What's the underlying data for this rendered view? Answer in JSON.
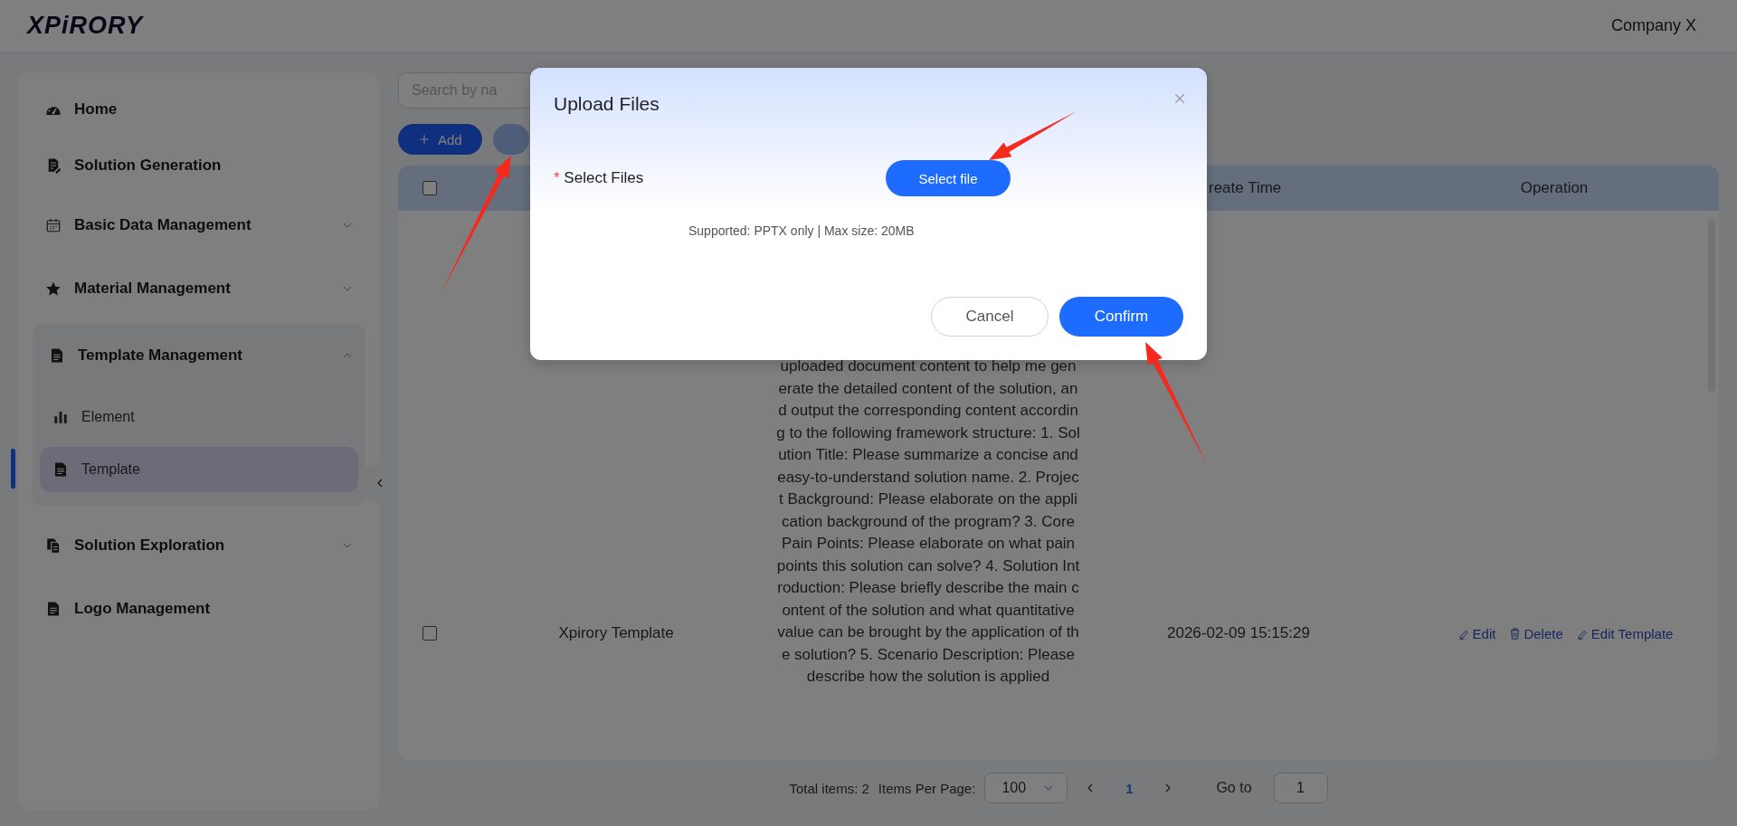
{
  "header": {
    "logo": "XPiRORY",
    "company": "Company X"
  },
  "sidebar": {
    "items": [
      {
        "label": "Home",
        "kind": "link",
        "selected": false
      },
      {
        "label": "Solution Generation",
        "kind": "link",
        "selected": false
      },
      {
        "label": "Basic Data Management",
        "kind": "group",
        "expanded": false,
        "selected": false
      },
      {
        "label": "Material Management",
        "kind": "group",
        "expanded": false,
        "selected": false
      },
      {
        "label": "Template Management",
        "kind": "group",
        "expanded": true,
        "selected": false,
        "children": [
          {
            "label": "Element",
            "selected": false
          },
          {
            "label": "Template",
            "selected": true
          }
        ]
      },
      {
        "label": "Solution Exploration",
        "kind": "group",
        "expanded": false,
        "selected": false
      },
      {
        "label": "Logo Management",
        "kind": "link",
        "selected": false
      }
    ]
  },
  "toolbar": {
    "search_placeholder": "Search by na",
    "buttons": [
      {
        "kind": "add",
        "label": "Add"
      },
      {
        "kind": "partial"
      }
    ]
  },
  "table": {
    "header_checked": false,
    "headers": {
      "create_time": "reate Time",
      "operation": "Operation"
    },
    "rows": [
      {
        "checked": false,
        "name": "Xpirory Template",
        "prompt": "uploaded document content to help me generate the detailed content of the solution, and output the corresponding content according to the following framework structure: 1. Solution Title: Please summarize a concise and easy-to-understand solution name. 2. Project Background: Please elaborate on the application background of the program? 3. Core Pain Points: Please elaborate on what pain points this solution can solve? 4. Solution Introduction: Please briefly describe the main content of the solution and what quantitative value can be brought by the application of the solution? 5. Scenario Description: Please describe how the solution is applied",
        "create_time": "2026-02-09 15:15:29",
        "actions": [
          {
            "kind": "edit",
            "label": "Edit"
          },
          {
            "kind": "delete",
            "label": "Delete"
          },
          {
            "kind": "edit",
            "label": "Edit Template"
          }
        ]
      }
    ]
  },
  "pagination": {
    "total": "Total items: 2",
    "per_page_label": "Items Per Page:",
    "per_page": "100",
    "pages": [
      {
        "label": "1",
        "selected": true
      }
    ],
    "goto_label": "Go to",
    "goto_value": "1"
  },
  "dialog": {
    "title": "Upload Files",
    "field_label": "Select Files",
    "required": true,
    "required_mark": "*",
    "select_button": "Select file",
    "hint": "Supported: PPTX only | Max size: 20MB",
    "buttons": [
      {
        "kind": "secondary",
        "label": "Cancel"
      },
      {
        "kind": "primary",
        "label": "Confirm"
      }
    ]
  },
  "annotations": [
    {
      "kind": "arrow"
    },
    {
      "kind": "arrow"
    },
    {
      "kind": "arrow"
    }
  ]
}
